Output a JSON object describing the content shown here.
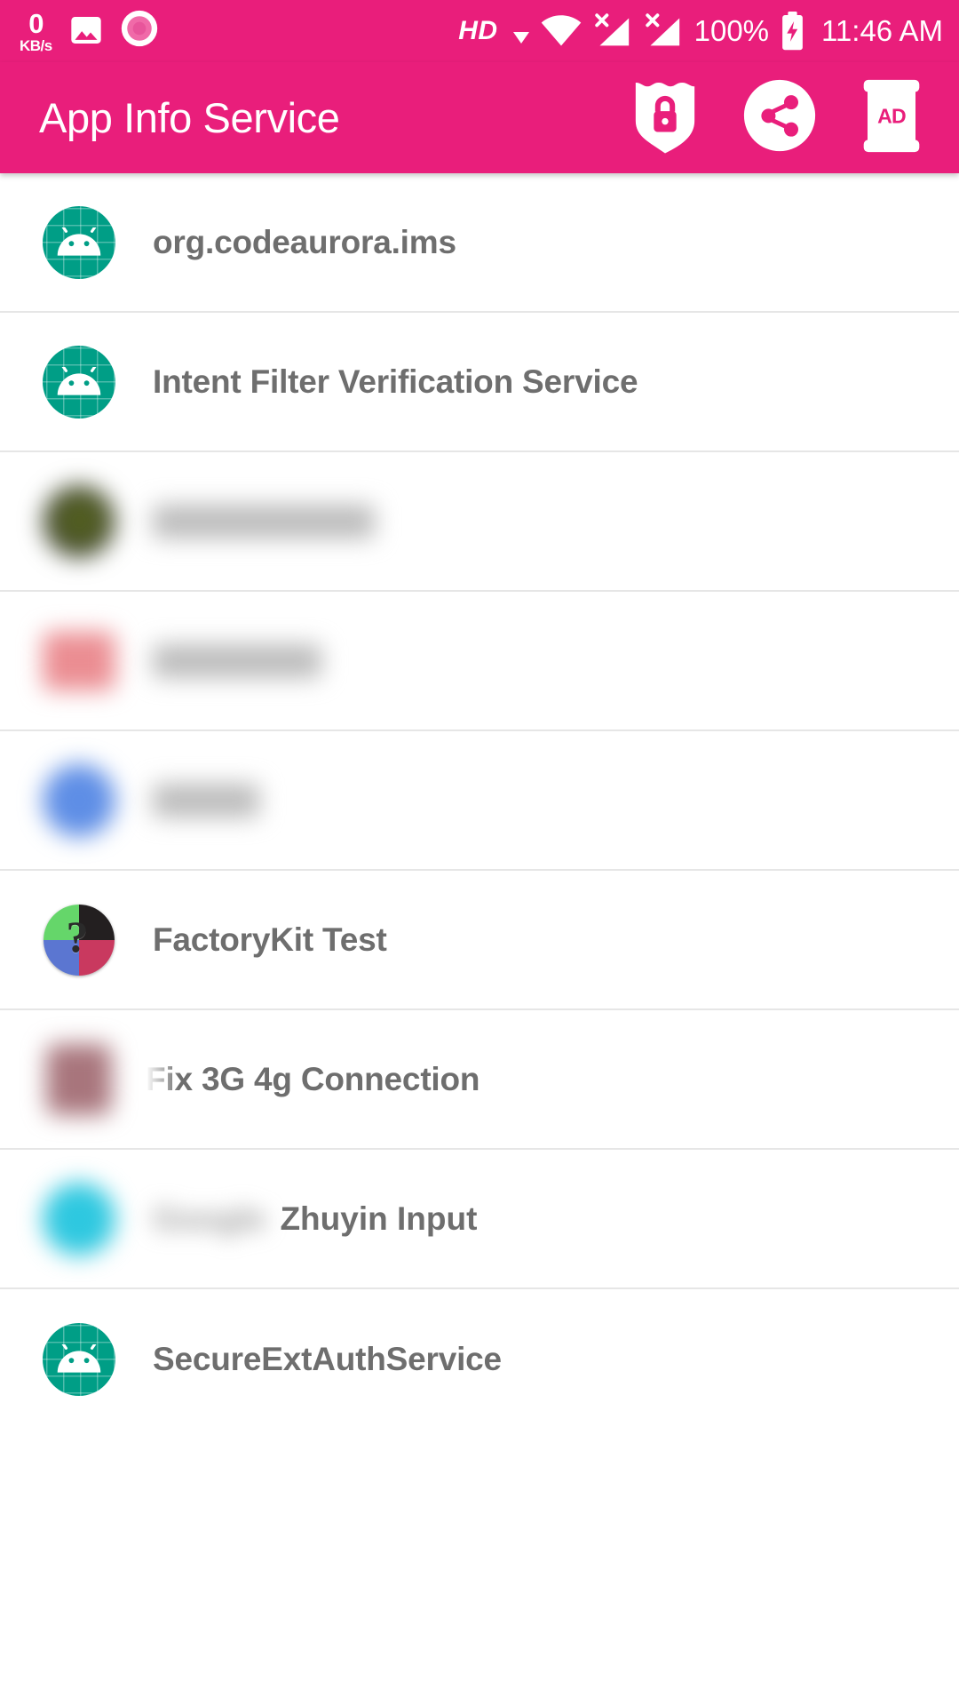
{
  "status_bar": {
    "network_speed_value": "0",
    "network_speed_unit": "KB/s",
    "icons": [
      "image-icon",
      "record-icon"
    ],
    "hd_label": "HD",
    "signal_icons": [
      "wifi-icon",
      "sim1-no-signal-icon",
      "sim2-no-signal-icon"
    ],
    "battery_percent": "100%",
    "battery_icon": "battery-charging-icon",
    "clock": "11:46 AM"
  },
  "app_bar": {
    "title": "App Info Service",
    "actions": [
      {
        "name": "shield-lock-icon",
        "label": "Privacy"
      },
      {
        "name": "share-icon",
        "label": "Share"
      },
      {
        "name": "ad-banner-icon",
        "label": "AD"
      }
    ]
  },
  "colors": {
    "accent_pink": "#E91E7B",
    "android_teal": "#009E86",
    "label_gray": "#6E6E6E",
    "divider": "#E6E6E6"
  },
  "list": {
    "items": [
      {
        "label": "org.codeaurora.ims",
        "icon": "android-app-icon",
        "redacted": false
      },
      {
        "label": "Intent Filter Verification Service",
        "icon": "android-app-icon",
        "redacted": false
      },
      {
        "label": "",
        "icon": "blurred-olive-circle-icon",
        "redacted": true
      },
      {
        "label": "",
        "icon": "blurred-pink-square-icon",
        "redacted": true
      },
      {
        "label": "",
        "icon": "blurred-blue-circle-icon",
        "redacted": true
      },
      {
        "label": "FactoryKit Test",
        "icon": "factorykit-quadrant-icon",
        "redacted": false
      },
      {
        "label": "Fix 3G 4g Connection",
        "icon": "blurred-rose-icon",
        "redacted": false
      },
      {
        "label": "Zhuyin Input",
        "hidden_prefix": "Google",
        "icon": "blurred-cyan-circle-icon",
        "redacted": false
      },
      {
        "label": "SecureExtAuthService",
        "icon": "android-app-icon",
        "redacted": false
      }
    ]
  }
}
